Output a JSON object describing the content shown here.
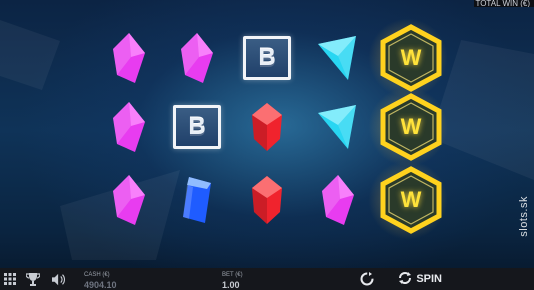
{
  "watermark": "slots.sk",
  "top_right_text": "TOTAL WIN (€)",
  "symbols": {
    "b_letter": "B",
    "w_letter": "W"
  },
  "grid": [
    [
      "magenta-gem",
      "magenta-gem",
      "b-bar",
      "cyan-gem",
      "w-wild"
    ],
    [
      "magenta-gem",
      "b-bar",
      "red-gem",
      "cyan-gem",
      "w-wild"
    ],
    [
      "magenta-gem",
      "blue-gem",
      "red-gem",
      "magenta-gem",
      "w-wild"
    ]
  ],
  "colors": {
    "magenta": "#e83cf0",
    "cyan": "#28d6f2",
    "red": "#f0232d",
    "blue": "#1f5cff",
    "gold": "#ffd21e"
  },
  "toolbar": {
    "cash_label": "CASH (€)",
    "cash_value": "4904.10",
    "bet_label": "BET (€)",
    "bet_value": "1.00",
    "spin_label": "SPIN"
  },
  "icons": [
    "menu-grid-icon",
    "trophy-icon",
    "speaker-icon",
    "autoplay-icon",
    "spin-arrows-icon"
  ]
}
